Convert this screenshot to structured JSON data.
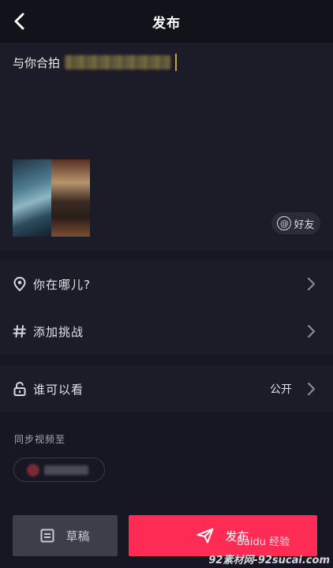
{
  "header": {
    "title": "发布"
  },
  "compose": {
    "caption_prefix": "与你合拍"
  },
  "mention_button": {
    "label": "好友"
  },
  "rows": {
    "location": "你在哪儿?",
    "challenge": "添加挑战",
    "privacy": "谁可以看",
    "privacy_value": "公开"
  },
  "sync": {
    "label": "同步视频至"
  },
  "actions": {
    "draft_label": "草稿",
    "publish_label": "发布"
  },
  "watermark": {
    "corner": "92素材网-92sucai.com",
    "baidu": "Baidu 经验"
  },
  "colors": {
    "background": "#161722",
    "panel": "#1b1c28",
    "publish": "#fe2c55",
    "draft": "#3d3e4a"
  }
}
